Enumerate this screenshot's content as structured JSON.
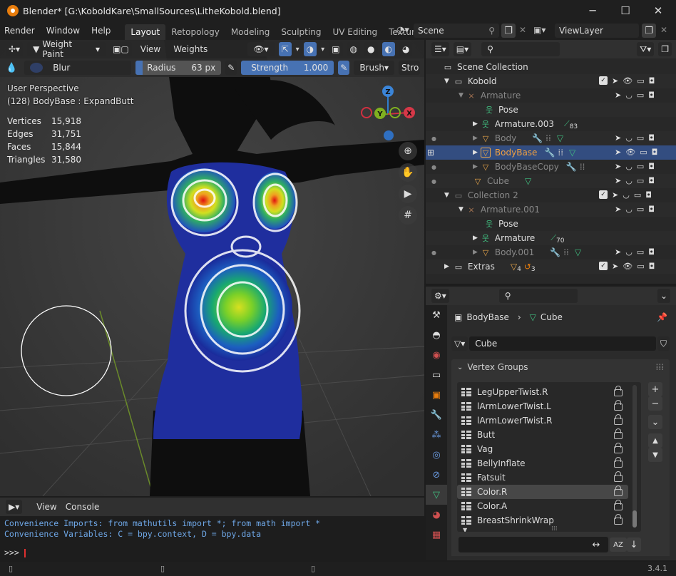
{
  "window": {
    "title": "Blender* [G:\\KoboldKare\\SmallSources\\LitheKobold.blend]",
    "minimize": "─",
    "maximize": "☐",
    "close": "✕"
  },
  "menu": [
    "Render",
    "Window",
    "Help"
  ],
  "workspaces": [
    "Layout",
    "Retopology",
    "Modeling",
    "Sculpting",
    "UV Editing",
    "Texture P"
  ],
  "scene": {
    "label": "Scene",
    "viewlayer": "ViewLayer"
  },
  "viewport": {
    "mode": "Weight Paint",
    "view_menu": "View",
    "weights_menu": "Weights",
    "brush_name": "Blur",
    "radius_label": "Radius",
    "radius_value": "63 px",
    "strength_label": "Strength",
    "strength_value": "1.000",
    "brush_menu": "Brush",
    "stroke_menu": "Stro",
    "perspective": "User Perspective",
    "object_info": "(128) BodyBase : ExpandButt",
    "stats": [
      {
        "label": "Vertices",
        "value": "15,918"
      },
      {
        "label": "Edges",
        "value": "31,751"
      },
      {
        "label": "Faces",
        "value": "15,844"
      },
      {
        "label": "Triangles",
        "value": "31,580"
      }
    ],
    "gizmo": {
      "z": "Z",
      "y": "Y",
      "x": "X"
    }
  },
  "outliner": {
    "search_placeholder": "",
    "rows": [
      {
        "label": "Scene Collection",
        "count": ""
      },
      {
        "label": "Kobold",
        "count": ""
      },
      {
        "label": "Armature",
        "count": ""
      },
      {
        "label": "Pose",
        "count": ""
      },
      {
        "label": "Armature.003",
        "count": "83"
      },
      {
        "label": "Body",
        "count": ""
      },
      {
        "label": "BodyBase",
        "count": ""
      },
      {
        "label": "BodyBaseCopy",
        "count": ""
      },
      {
        "label": "Cube",
        "count": ""
      },
      {
        "label": "Collection 2",
        "count": ""
      },
      {
        "label": "Armature.001",
        "count": ""
      },
      {
        "label": "Pose",
        "count": ""
      },
      {
        "label": "Armature",
        "count": "70"
      },
      {
        "label": "Body.001",
        "count": ""
      },
      {
        "label": "Extras",
        "count": "4",
        "count2": "3"
      }
    ]
  },
  "properties": {
    "breadcrumb_object": "BodyBase",
    "breadcrumb_mesh": "Cube",
    "mesh_name": "Cube",
    "panel_title": "Vertex Groups",
    "vertex_groups": [
      "LegUpperTwist.R",
      "lArmLowerTwist.L",
      "lArmLowerTwist.R",
      "Butt",
      "Vag",
      "BellyInflate",
      "Fatsuit",
      "Color.R",
      "Color.A",
      "BreastShrinkWrap"
    ],
    "selected_group": "Color.R",
    "filter_value": "",
    "add": "+",
    "remove": "−",
    "menu": "⌄",
    "up": "▲",
    "down": "▼",
    "sort_alpha": "AZ",
    "sort_dir": "↓",
    "swap": "↔"
  },
  "console": {
    "view_menu": "View",
    "console_menu": "Console",
    "lines": [
      "Convenience Imports:   from mathutils import *; from math import *",
      "Convenience Variables: C = bpy.context, D = bpy.data"
    ],
    "prompt": ">>> "
  },
  "status": {
    "version": "3.4.1"
  },
  "colors": {
    "accent": "#4772b3",
    "selection": "#334d80",
    "orange": "#e87d0d",
    "mesh_icon": "#e8a64a"
  }
}
